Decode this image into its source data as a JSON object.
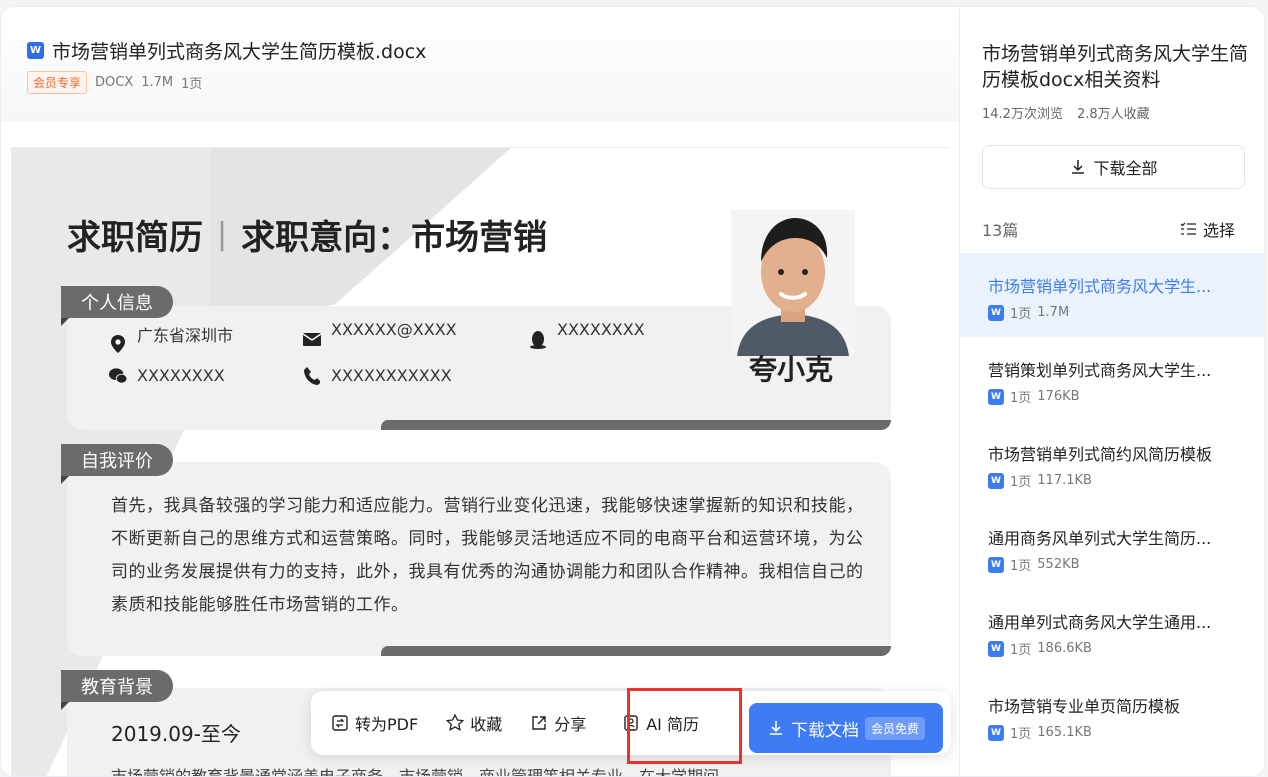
{
  "doc": {
    "file_icon": "word-icon",
    "title": "市场营销单列式商务风大学生简历模板.docx",
    "vip_badge": "会员专享",
    "format": "DOCX",
    "size": "1.7M",
    "pages": "1页"
  },
  "resume": {
    "title": "求职简历",
    "separator": "|",
    "intent": "求职意向：市场营销",
    "name": "夸小克",
    "sections": {
      "personal": "个人信息",
      "evaluation": "自我评价",
      "education": "教育背景"
    },
    "info": {
      "location": "广东省深圳市",
      "email": "XXXXXX@XXXX",
      "qq": "XXXXXXXX",
      "wechat": "XXXXXXXX",
      "phone": "XXXXXXXXXXX"
    },
    "evaluation_text": "首先，我具备较强的学习能力和适应能力。营销行业变化迅速，我能够快速掌握新的知识和技能，不断更新自己的思维方式和运营策略。同时，我能够灵活地适应不同的电商平台和运营环境，为公司的业务发展提供有力的支持，此外，我具有优秀的沟通协调能力和团队合作精神。我相信自己的素质和技能能够胜任市场营销的工作。",
    "edu_date": "2019.09-至今",
    "edu_text": "市场营销的教育背景通常涵盖电子商务、市场营销、商业管理等相关专业。在大学期间，"
  },
  "toolbar": {
    "to_pdf": "转为PDF",
    "favorite": "收藏",
    "share": "分享",
    "ai_resume": "AI 简历",
    "download": "下载文档",
    "free_tag": "会员免费"
  },
  "sidebar": {
    "title": "市场营销单列式商务风大学生简历模板docx相关资料",
    "views": "14.2万次浏览",
    "favorites": "2.8万人收藏",
    "download_all": "下载全部",
    "count": "13篇",
    "select": "选择",
    "items": [
      {
        "title": "市场营销单列式商务风大学生...",
        "pages": "1页",
        "size": "1.7M"
      },
      {
        "title": "营销策划单列式商务风大学生...",
        "pages": "1页",
        "size": "176KB"
      },
      {
        "title": "市场营销单列式简约风简历模板",
        "pages": "1页",
        "size": "117.1KB"
      },
      {
        "title": "通用商务风单列式大学生简历...",
        "pages": "1页",
        "size": "552KB"
      },
      {
        "title": "通用单列式商务风大学生通用...",
        "pages": "1页",
        "size": "186.6KB"
      },
      {
        "title": "市场营销专业单页简历模板",
        "pages": "1页",
        "size": "165.1KB"
      }
    ]
  },
  "colors": {
    "accent": "#3f7bf4",
    "highlight": "#e8332e",
    "vip": "#ef6b2c"
  }
}
